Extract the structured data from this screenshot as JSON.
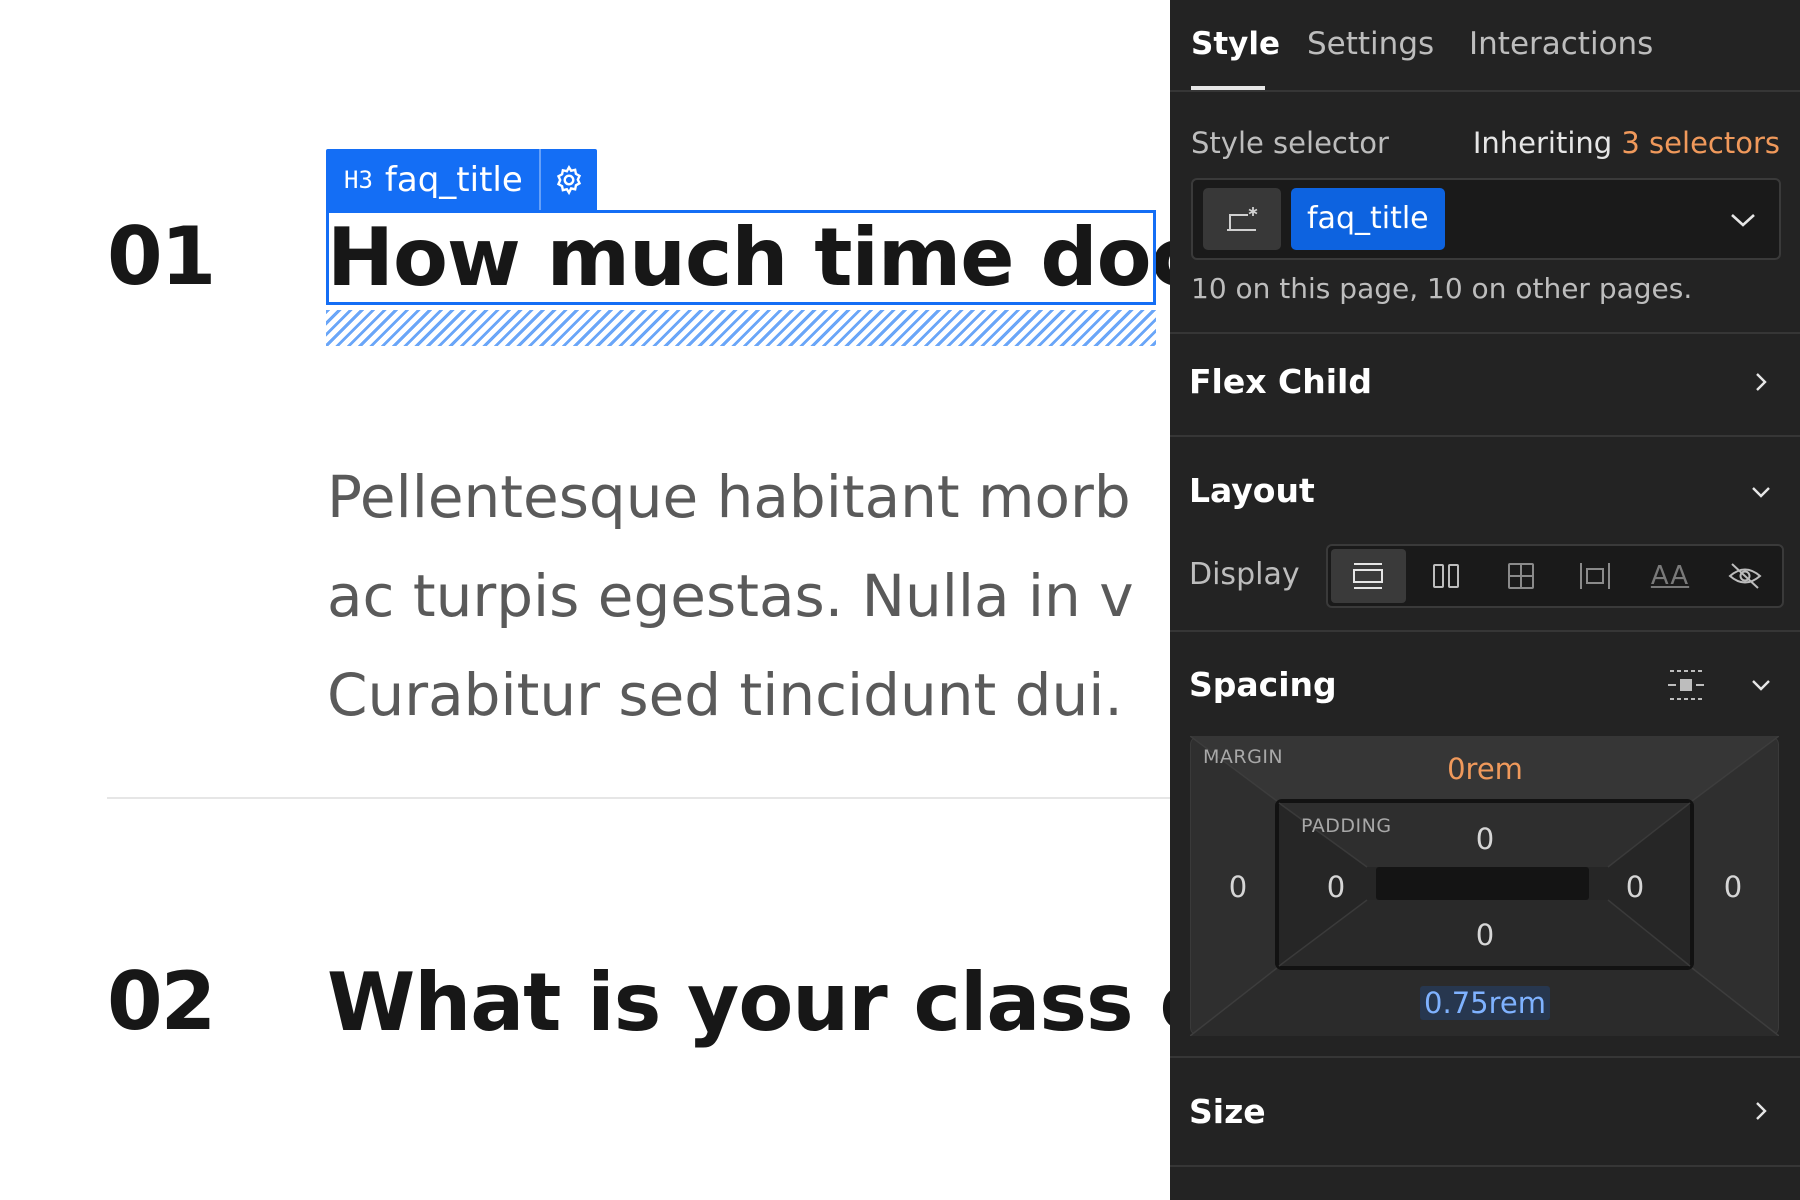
{
  "canvas": {
    "faqs": [
      {
        "number": "01",
        "question": "How much time doc"
      },
      {
        "number": "02",
        "question": "What is your class co"
      }
    ],
    "answer_lines": [
      "Pellentesque habitant morb",
      "ac turpis egestas. Nulla in v",
      "Curabitur sed tincidunt dui."
    ],
    "selection": {
      "tag": "H3",
      "class_name": "faq_title",
      "color": "#146ef5"
    }
  },
  "panel": {
    "tabs": [
      {
        "label": "Style",
        "active": true
      },
      {
        "label": "Settings",
        "active": false
      },
      {
        "label": "Interactions",
        "active": false
      }
    ],
    "style_selector": {
      "label": "Style selector",
      "inheriting_prefix": "Inheriting",
      "inheriting_count": "3 selectors",
      "selected_class": "faq_title",
      "note": "10 on this page, 10 on other pages."
    },
    "sections": {
      "flex_child": "Flex Child",
      "layout": "Layout",
      "spacing": "Spacing",
      "size": "Size"
    },
    "layout": {
      "display_label": "Display",
      "display_options": [
        "block-icon",
        "flex-icon",
        "grid-icon",
        "inline-block-icon",
        "inline-icon",
        "none-icon"
      ],
      "active_display": "block-icon",
      "inline_glyph": "AA"
    },
    "spacing": {
      "margin_label": "MARGIN",
      "padding_label": "PADDING",
      "margin": {
        "top": "0rem",
        "right": "0",
        "bottom": "0.75rem",
        "left": "0"
      },
      "padding": {
        "top": "0",
        "right": "0",
        "bottom": "0",
        "left": "0"
      }
    },
    "colors": {
      "accent": "#146ef5",
      "orange": "#f0995b",
      "panel_bg": "#232323"
    }
  }
}
